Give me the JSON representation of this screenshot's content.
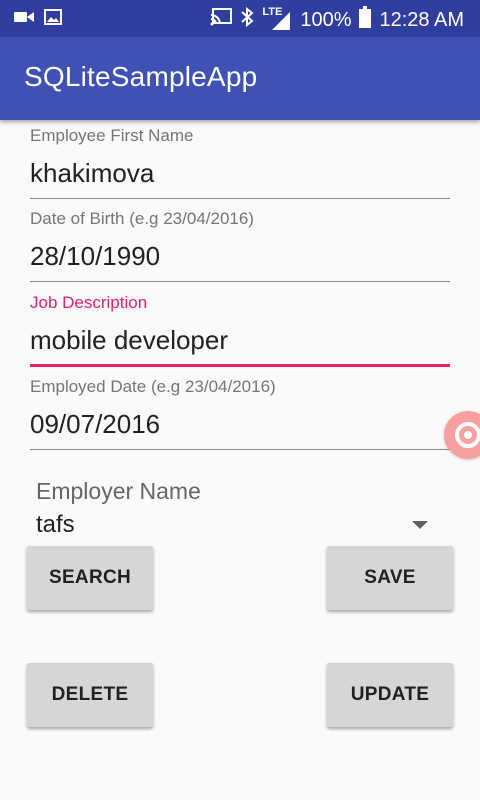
{
  "status_bar": {
    "battery": "100%",
    "time": "12:28 AM",
    "network_label": "LTE"
  },
  "app_bar": {
    "title": "SQLiteSampleApp"
  },
  "form": {
    "first_name": {
      "label": "Employee First Name",
      "value": "khakimova"
    },
    "dob": {
      "label": "Date of Birth (e.g 23/04/2016)",
      "value": "28/10/1990"
    },
    "job": {
      "label": "Job Description",
      "value": "mobile developer"
    },
    "employed": {
      "label": "Employed Date (e.g 23/04/2016)",
      "value": "09/07/2016"
    },
    "employer": {
      "label": "Employer Name",
      "selected": "tafs"
    }
  },
  "buttons": {
    "search": "SEARCH",
    "save": "SAVE",
    "delete": "DELETE",
    "update": "UPDATE"
  },
  "colors": {
    "primary": "#3f51b5",
    "primary_dark": "#303f9f",
    "accent": "#e91e63"
  },
  "icons": [
    "video-camera-icon",
    "image-icon",
    "cast-icon",
    "bluetooth-icon",
    "signal-icon",
    "battery-icon",
    "floating-record-icon"
  ]
}
